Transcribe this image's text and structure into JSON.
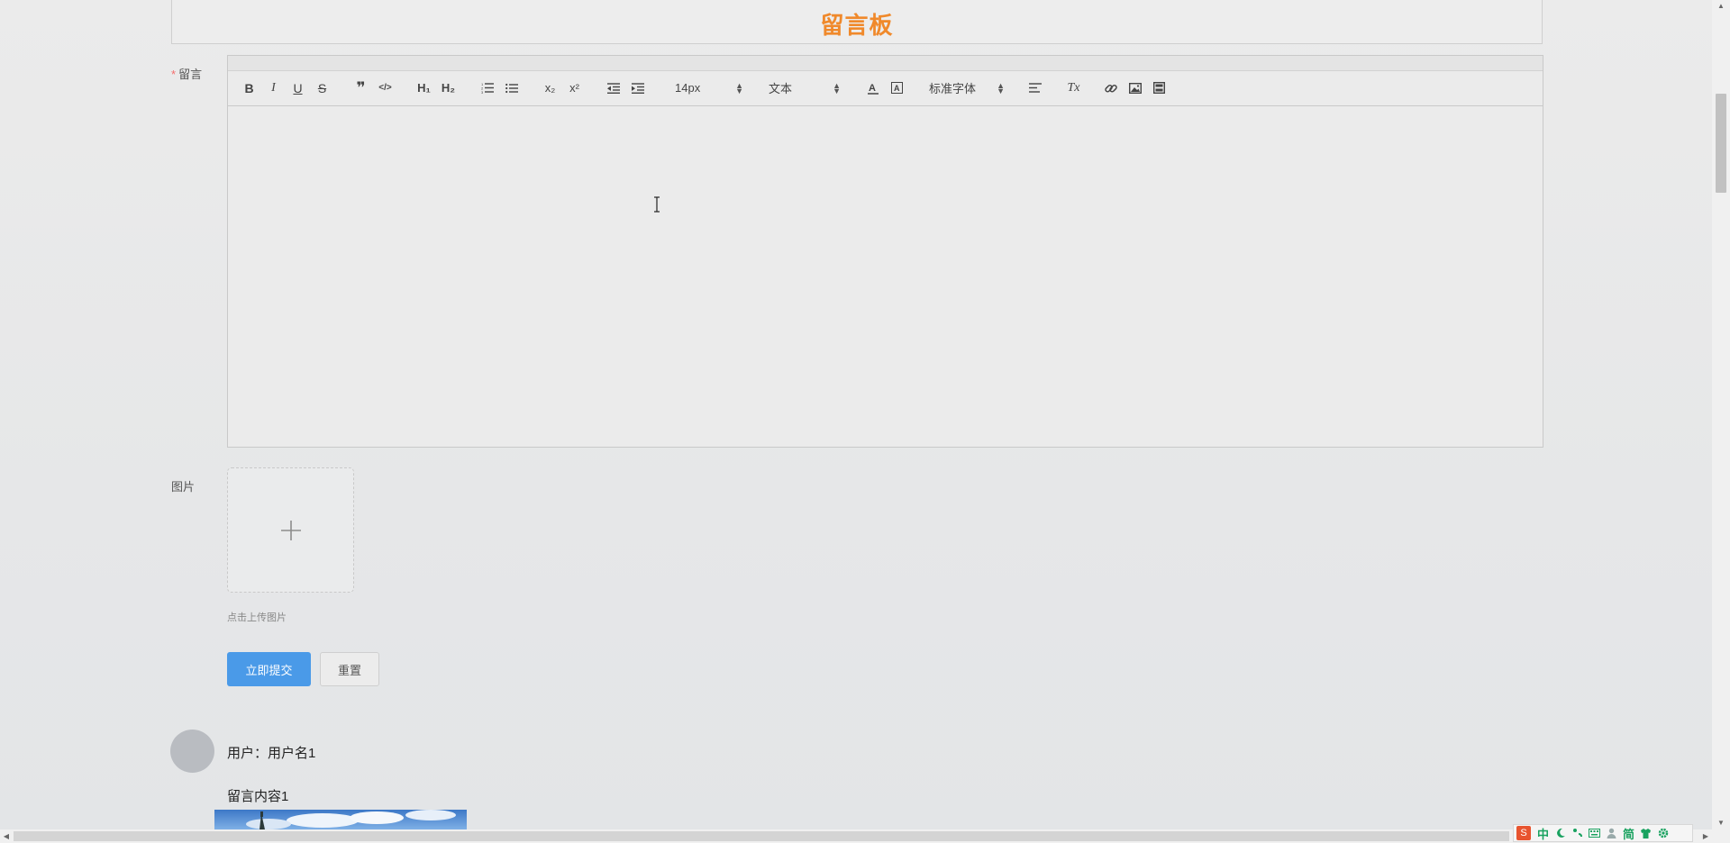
{
  "header": {
    "title": "留言板"
  },
  "form": {
    "message_label": "留言",
    "required_mark": "*",
    "image_label": "图片",
    "upload_tip": "点击上传图片",
    "upload_plus": "+",
    "submit_label": "立即提交",
    "reset_label": "重置"
  },
  "toolbar": {
    "bold": "B",
    "italic": "I",
    "underline": "U",
    "strike": "S",
    "blockquote": "❞",
    "code": "</>",
    "h1": "H₁",
    "h2": "H₂",
    "subscript": "x₂",
    "superscript": "x²",
    "size_value": "14px",
    "header_value": "文本",
    "font_value": "标准字体",
    "clean": "Tx"
  },
  "comments": [
    {
      "user_line": "用户：用户名1",
      "content": "留言内容1"
    }
  ],
  "ime": {
    "logo": "S",
    "mode": "中",
    "charset": "简"
  },
  "colors": {
    "title": "#f0892b",
    "primary": "#4a9ae8",
    "required": "#f56c6c"
  }
}
